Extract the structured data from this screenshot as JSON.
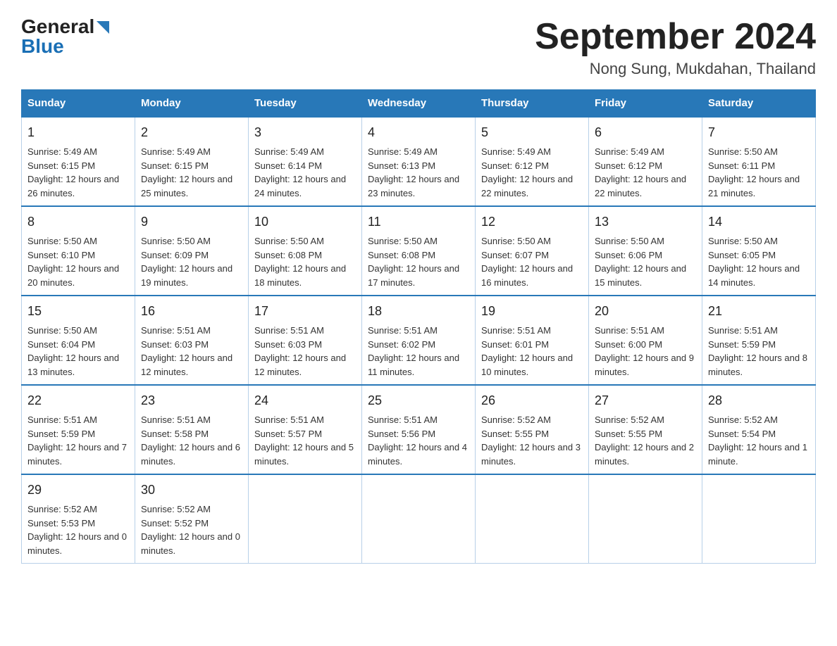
{
  "logo": {
    "general": "General",
    "blue": "Blue"
  },
  "title": "September 2024",
  "subtitle": "Nong Sung, Mukdahan, Thailand",
  "days_header": [
    "Sunday",
    "Monday",
    "Tuesday",
    "Wednesday",
    "Thursday",
    "Friday",
    "Saturday"
  ],
  "weeks": [
    [
      {
        "day": "1",
        "sunrise": "5:49 AM",
        "sunset": "6:15 PM",
        "daylight": "12 hours and 26 minutes."
      },
      {
        "day": "2",
        "sunrise": "5:49 AM",
        "sunset": "6:15 PM",
        "daylight": "12 hours and 25 minutes."
      },
      {
        "day": "3",
        "sunrise": "5:49 AM",
        "sunset": "6:14 PM",
        "daylight": "12 hours and 24 minutes."
      },
      {
        "day": "4",
        "sunrise": "5:49 AM",
        "sunset": "6:13 PM",
        "daylight": "12 hours and 23 minutes."
      },
      {
        "day": "5",
        "sunrise": "5:49 AM",
        "sunset": "6:12 PM",
        "daylight": "12 hours and 22 minutes."
      },
      {
        "day": "6",
        "sunrise": "5:49 AM",
        "sunset": "6:12 PM",
        "daylight": "12 hours and 22 minutes."
      },
      {
        "day": "7",
        "sunrise": "5:50 AM",
        "sunset": "6:11 PM",
        "daylight": "12 hours and 21 minutes."
      }
    ],
    [
      {
        "day": "8",
        "sunrise": "5:50 AM",
        "sunset": "6:10 PM",
        "daylight": "12 hours and 20 minutes."
      },
      {
        "day": "9",
        "sunrise": "5:50 AM",
        "sunset": "6:09 PM",
        "daylight": "12 hours and 19 minutes."
      },
      {
        "day": "10",
        "sunrise": "5:50 AM",
        "sunset": "6:08 PM",
        "daylight": "12 hours and 18 minutes."
      },
      {
        "day": "11",
        "sunrise": "5:50 AM",
        "sunset": "6:08 PM",
        "daylight": "12 hours and 17 minutes."
      },
      {
        "day": "12",
        "sunrise": "5:50 AM",
        "sunset": "6:07 PM",
        "daylight": "12 hours and 16 minutes."
      },
      {
        "day": "13",
        "sunrise": "5:50 AM",
        "sunset": "6:06 PM",
        "daylight": "12 hours and 15 minutes."
      },
      {
        "day": "14",
        "sunrise": "5:50 AM",
        "sunset": "6:05 PM",
        "daylight": "12 hours and 14 minutes."
      }
    ],
    [
      {
        "day": "15",
        "sunrise": "5:50 AM",
        "sunset": "6:04 PM",
        "daylight": "12 hours and 13 minutes."
      },
      {
        "day": "16",
        "sunrise": "5:51 AM",
        "sunset": "6:03 PM",
        "daylight": "12 hours and 12 minutes."
      },
      {
        "day": "17",
        "sunrise": "5:51 AM",
        "sunset": "6:03 PM",
        "daylight": "12 hours and 12 minutes."
      },
      {
        "day": "18",
        "sunrise": "5:51 AM",
        "sunset": "6:02 PM",
        "daylight": "12 hours and 11 minutes."
      },
      {
        "day": "19",
        "sunrise": "5:51 AM",
        "sunset": "6:01 PM",
        "daylight": "12 hours and 10 minutes."
      },
      {
        "day": "20",
        "sunrise": "5:51 AM",
        "sunset": "6:00 PM",
        "daylight": "12 hours and 9 minutes."
      },
      {
        "day": "21",
        "sunrise": "5:51 AM",
        "sunset": "5:59 PM",
        "daylight": "12 hours and 8 minutes."
      }
    ],
    [
      {
        "day": "22",
        "sunrise": "5:51 AM",
        "sunset": "5:59 PM",
        "daylight": "12 hours and 7 minutes."
      },
      {
        "day": "23",
        "sunrise": "5:51 AM",
        "sunset": "5:58 PM",
        "daylight": "12 hours and 6 minutes."
      },
      {
        "day": "24",
        "sunrise": "5:51 AM",
        "sunset": "5:57 PM",
        "daylight": "12 hours and 5 minutes."
      },
      {
        "day": "25",
        "sunrise": "5:51 AM",
        "sunset": "5:56 PM",
        "daylight": "12 hours and 4 minutes."
      },
      {
        "day": "26",
        "sunrise": "5:52 AM",
        "sunset": "5:55 PM",
        "daylight": "12 hours and 3 minutes."
      },
      {
        "day": "27",
        "sunrise": "5:52 AM",
        "sunset": "5:55 PM",
        "daylight": "12 hours and 2 minutes."
      },
      {
        "day": "28",
        "sunrise": "5:52 AM",
        "sunset": "5:54 PM",
        "daylight": "12 hours and 1 minute."
      }
    ],
    [
      {
        "day": "29",
        "sunrise": "5:52 AM",
        "sunset": "5:53 PM",
        "daylight": "12 hours and 0 minutes."
      },
      {
        "day": "30",
        "sunrise": "5:52 AM",
        "sunset": "5:52 PM",
        "daylight": "12 hours and 0 minutes."
      },
      null,
      null,
      null,
      null,
      null
    ]
  ]
}
